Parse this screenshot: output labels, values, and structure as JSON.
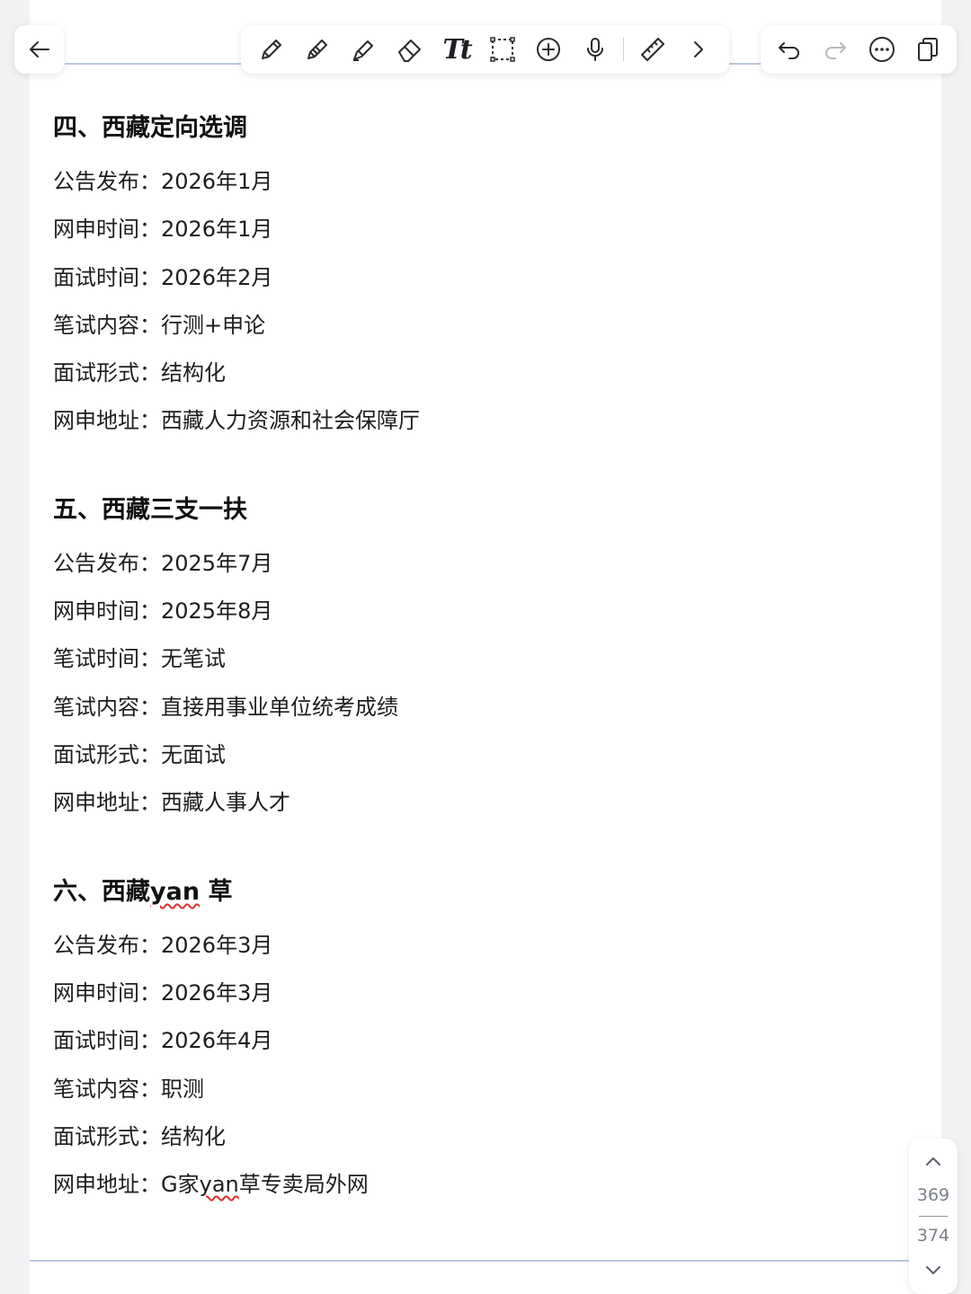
{
  "toolbar": {
    "left_icons": [
      "arrow-left-icon"
    ],
    "tools": [
      "pen-icon",
      "pencil-icon",
      "highlighter-icon",
      "eraser-icon",
      "text-tool-icon",
      "lasso-select-icon",
      "add-circle-icon",
      "microphone-icon",
      "ruler-icon",
      "chevron-right-icon"
    ],
    "text_tool_label": "Tt",
    "right_icons": [
      "undo-icon",
      "redo-icon",
      "more-icon",
      "pages-icon"
    ]
  },
  "sections": [
    {
      "title_prefix": "四、西藏定向选调",
      "title_mid": "",
      "title_suffix": "",
      "rows": [
        {
          "label": "公告发布：",
          "value": "2026年1月"
        },
        {
          "label": "网申时间：",
          "value": "2026年1月"
        },
        {
          "label": "面试时间：",
          "value": "2026年2月"
        },
        {
          "label": "笔试内容：",
          "value": "行测+申论"
        },
        {
          "label": "面试形式：",
          "value": "结构化"
        },
        {
          "label": "网申地址：",
          "value": "西藏人力资源和社会保障厅"
        }
      ]
    },
    {
      "title_prefix": "五、西藏三支一扶",
      "title_mid": "",
      "title_suffix": "",
      "rows": [
        {
          "label": "公告发布：",
          "value": "2025年7月"
        },
        {
          "label": "网申时间：",
          "value": "2025年8月"
        },
        {
          "label": "笔试时间：",
          "value": "无笔试"
        },
        {
          "label": "笔试内容：",
          "value": "直接用事业单位统考成绩"
        },
        {
          "label": "面试形式：",
          "value": "无面试"
        },
        {
          "label": "网申地址：",
          "value": "西藏人事人才"
        }
      ]
    },
    {
      "title_prefix": "六、西藏",
      "title_mid": "yan",
      "title_suffix": " 草",
      "rows": [
        {
          "label": "公告发布：",
          "value": "2026年3月"
        },
        {
          "label": "网申时间：",
          "value": "2026年3月"
        },
        {
          "label": "面试时间：",
          "value": "2026年4月"
        },
        {
          "label": "笔试内容：",
          "value": "职测"
        },
        {
          "label": "面试形式：",
          "value": "结构化"
        },
        {
          "label": "网申地址：",
          "value_prefix": "G家",
          "value_mid": "yan",
          "value_suffix": "草专卖局外网"
        }
      ]
    }
  ],
  "pager": {
    "current_page": "369",
    "total_pages": "374"
  },
  "colors": {
    "highlight": "#fdd694",
    "spellcheck_underline": "#e03030",
    "rule": "#b9c6dc"
  }
}
